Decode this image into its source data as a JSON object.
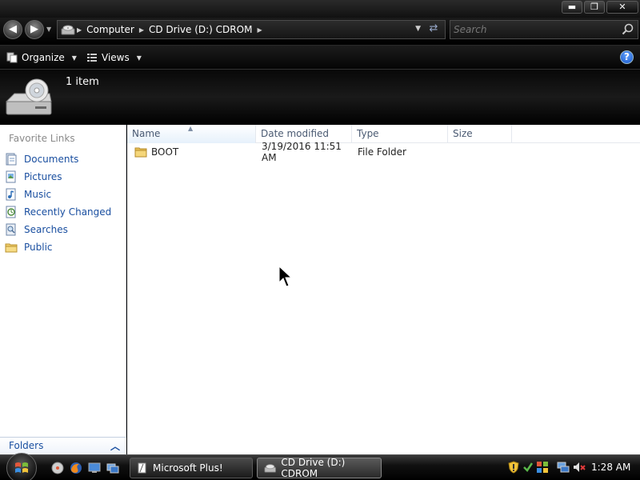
{
  "window": {
    "caption_buttons": {
      "minimize": "▬",
      "maximize": "❐",
      "close": "✕"
    }
  },
  "address": {
    "crumbs": [
      "Computer",
      "CD Drive (D:) CDROM"
    ]
  },
  "search": {
    "placeholder": "Search"
  },
  "toolbar": {
    "organize": "Organize",
    "views": "Views",
    "help": "?"
  },
  "details": {
    "item_count": "1 item"
  },
  "nav": {
    "heading": "Favorite Links",
    "items": [
      {
        "label": "Documents",
        "icon": "documents-icon"
      },
      {
        "label": "Pictures",
        "icon": "pictures-icon"
      },
      {
        "label": "Music",
        "icon": "music-icon"
      },
      {
        "label": "Recently Changed",
        "icon": "recently-changed-icon"
      },
      {
        "label": "Searches",
        "icon": "searches-icon"
      },
      {
        "label": "Public",
        "icon": "public-folder-icon"
      }
    ],
    "folders_label": "Folders"
  },
  "columns": {
    "name": "Name",
    "date": "Date modified",
    "type": "Type",
    "size": "Size"
  },
  "files": [
    {
      "name": "BOOT",
      "date": "3/19/2016 11:51 AM",
      "type": "File Folder",
      "size": ""
    }
  ],
  "taskbar": {
    "tasks": [
      "Microsoft Plus!",
      "CD Drive (D:) CDROM"
    ],
    "clock": "1:28 AM"
  },
  "colors": {
    "link_blue": "#1a4fa0",
    "header_text": "#4a5a72",
    "chrome_black": "#000000"
  }
}
